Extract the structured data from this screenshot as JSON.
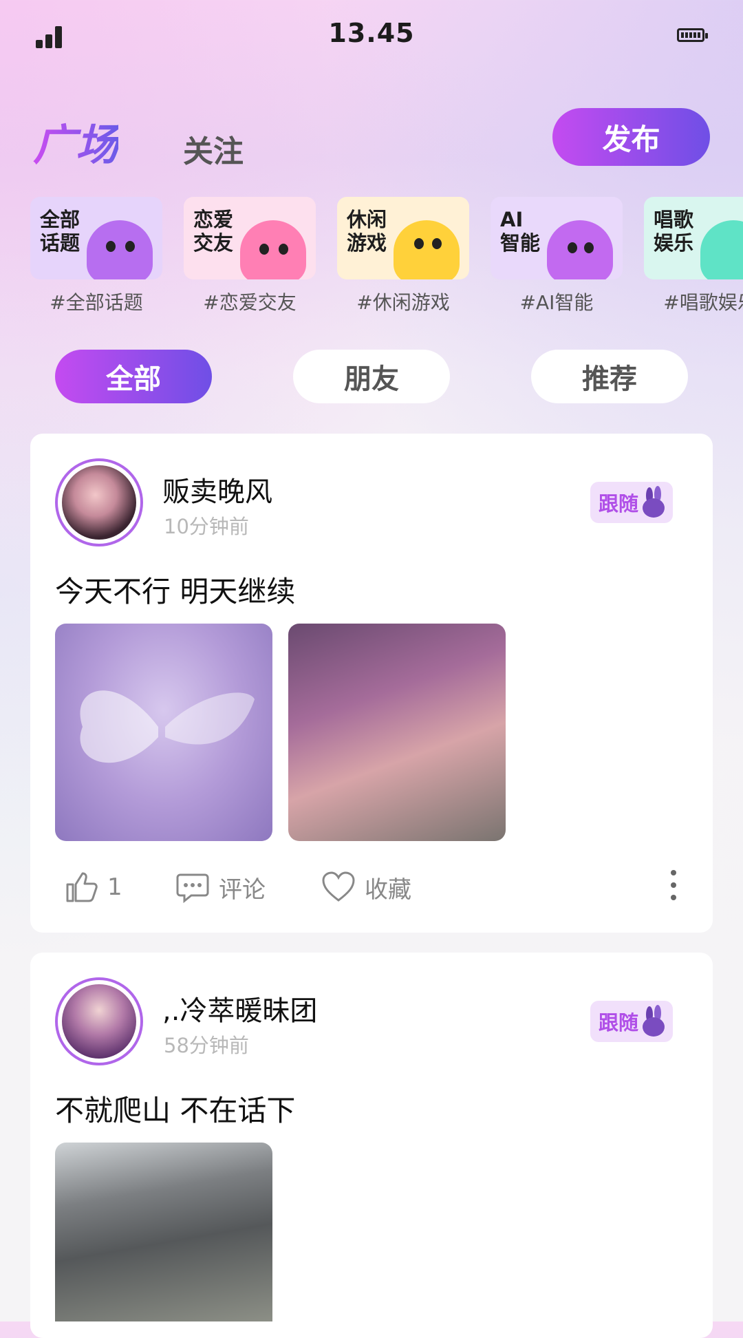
{
  "status_bar": {
    "time": "13.45"
  },
  "header": {
    "title": "广场",
    "follow_tab": "关注",
    "publish_button": "发布"
  },
  "topics": [
    {
      "card_label": "全部\n话题",
      "tag": "#全部话题",
      "bg": "#e6d4fb",
      "blob": "#b76ef0"
    },
    {
      "card_label": "恋爱\n交友",
      "tag": "#恋爱交友",
      "bg": "#fde0ee",
      "blob": "#ff7fb4"
    },
    {
      "card_label": "休闲\n游戏",
      "tag": "#休闲游戏",
      "bg": "#fff1d6",
      "blob": "#ffd13a"
    },
    {
      "card_label": "AI\n智能",
      "tag": "#AI智能",
      "bg": "#e9d9fb",
      "blob": "#c26af0"
    },
    {
      "card_label": "唱歌\n娱乐",
      "tag": "#唱歌娱乐",
      "bg": "#d9f6ef",
      "blob": "#5fe3c6"
    }
  ],
  "filter_tabs": [
    "全部",
    "朋友",
    "推荐"
  ],
  "posts": [
    {
      "username": "贩卖晚风",
      "time": "10分钟前",
      "follow_label": "跟随",
      "text": "今天不行 明天继续",
      "likes": "1",
      "comment_label": "评论",
      "favorite_label": "收藏"
    },
    {
      "username": ",.冷萃暖昧团",
      "time": "58分钟前",
      "follow_label": "跟随",
      "text": "不就爬山 不在话下"
    }
  ],
  "colors": {
    "accent_start": "#c44bf0",
    "accent_end": "#6f4fe6"
  }
}
